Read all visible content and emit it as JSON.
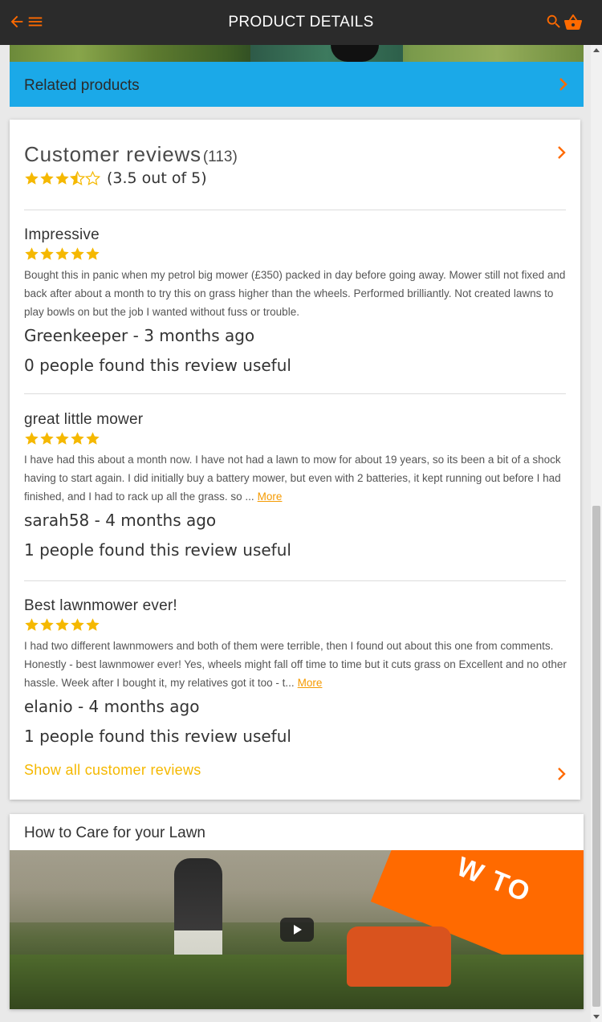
{
  "header": {
    "title": "PRODUCT DETAILS",
    "back_icon": "arrow-left-icon",
    "menu_icon": "hamburger-menu-icon",
    "search_icon": "search-icon",
    "basket_icon": "basket-icon"
  },
  "related": {
    "label": "Related products",
    "color": "#1ba9e8"
  },
  "reviews": {
    "title": "Customer reviews",
    "count": "(113)",
    "rating_text": "(3.5 out of 5)",
    "average_rating": 3.5,
    "items": [
      {
        "title": "Impressive",
        "rating": 5,
        "body": "Bought this in panic when my petrol big mower (£350) packed in day before going away. Mower still not fixed and back after about a month to try this on grass higher than the wheels. Performed brilliantly. Not created lawns to play bowls on but the job I wanted without fuss or trouble.",
        "more": "",
        "author": "Greenkeeper - 3 months ago",
        "useful": "0 people found this review useful"
      },
      {
        "title": "great little mower",
        "rating": 5,
        "body": "I have had this about a month now. I have not had a lawn to mow for about 19 years, so its been a bit of a shock having to start again. I did initially buy a battery mower, but even with 2 batteries, it kept running out before I had finished, and I had to rack up all the grass. so ...",
        "more": "More",
        "author": "sarah58 - 4 months ago",
        "useful": "1 people found this review useful"
      },
      {
        "title": "Best lawnmower ever!",
        "rating": 5,
        "body": "I had two different lawnmowers and both of them were terrible, then I found out about this one from comments. Honestly - best lawnmower ever! Yes, wheels might fall off time to time but it cuts grass on Excellent and no other hassle. Week after I bought it, my relatives got it too - t...",
        "more": "More",
        "author": "elanio - 4 months ago",
        "useful": "1 people found this review useful"
      }
    ],
    "show_all": "Show all customer reviews",
    "star_color": "#f5b800",
    "link_color": "#f59a00"
  },
  "care": {
    "title": "How to Care for your Lawn",
    "video_overlay_text": "W TO",
    "play_icon": "play-icon"
  }
}
